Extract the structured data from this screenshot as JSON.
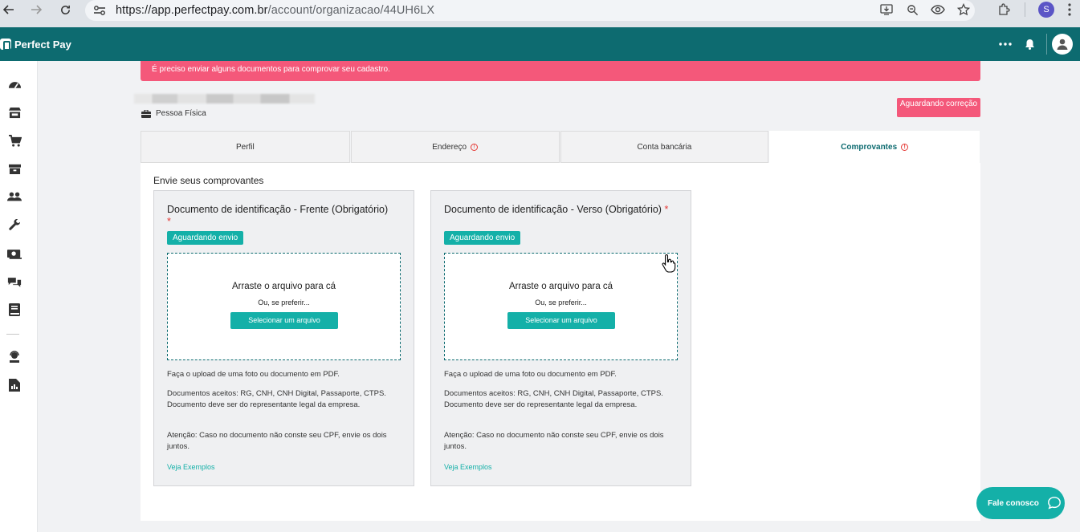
{
  "browser": {
    "url_host": "https://app.perfectpay.com.br",
    "url_path": "/account/organizacao/44UH6LX",
    "profile_initial": "S"
  },
  "header": {
    "brand": "Perfect Pay"
  },
  "alert": {
    "text": "É preciso enviar alguns documentos para comprovar seu cadastro."
  },
  "account": {
    "type_label": "Pessoa Física",
    "status_label": "Aguardando correção"
  },
  "tabs": [
    {
      "label": "Perfil",
      "warning": false
    },
    {
      "label": "Endereço",
      "warning": true
    },
    {
      "label": "Conta bancária",
      "warning": false
    },
    {
      "label": "Comprovantes",
      "warning": true
    }
  ],
  "comprovantes": {
    "title": "Envie seus comprovantes",
    "cards": [
      {
        "title": "Documento de identificação - Frente (Obrigatório)",
        "required_mark": "*",
        "status": "Aguardando envio",
        "drop_title": "Arraste o arquivo para cá",
        "drop_sub": "Ou, se preferir...",
        "select_button": "Selecionar um arquivo",
        "info_upload": "Faça o upload de uma foto ou documento em PDF.",
        "info_accepted": "Documentos aceitos: RG, CNH, CNH Digital, Passaporte, CTPS. Documento deve ser do representante legal da empresa.",
        "info_attention": "Atenção: Caso no documento não conste seu CPF, envie os dois juntos.",
        "examples_link": "Veja Exemplos"
      },
      {
        "title": "Documento de identificação - Verso (Obrigatório)",
        "required_mark": "*",
        "status": "Aguardando envio",
        "drop_title": "Arraste o arquivo para cá",
        "drop_sub": "Ou, se preferir...",
        "select_button": "Selecionar um arquivo",
        "info_upload": "Faça o upload de uma foto ou documento em PDF.",
        "info_accepted": "Documentos aceitos: RG, CNH, CNH Digital, Passaporte, CTPS. Documento deve ser do representante legal da empresa.",
        "info_attention": "Atenção: Caso no documento não conste seu CPF, envie os dois juntos.",
        "examples_link": "Veja Exemplos"
      }
    ]
  },
  "chat": {
    "label": "Fale conosco"
  },
  "sidebar_icons": [
    "dashboard-icon",
    "store-icon",
    "cart-icon",
    "box-icon",
    "users-icon",
    "wrench-icon",
    "money-icon",
    "chat-icon",
    "book-icon",
    "support-agent-icon",
    "report-icon"
  ],
  "colors": {
    "brand_teal": "#0d6b70",
    "accent_teal": "#14b0a8",
    "alert_pink": "#f4587a"
  }
}
